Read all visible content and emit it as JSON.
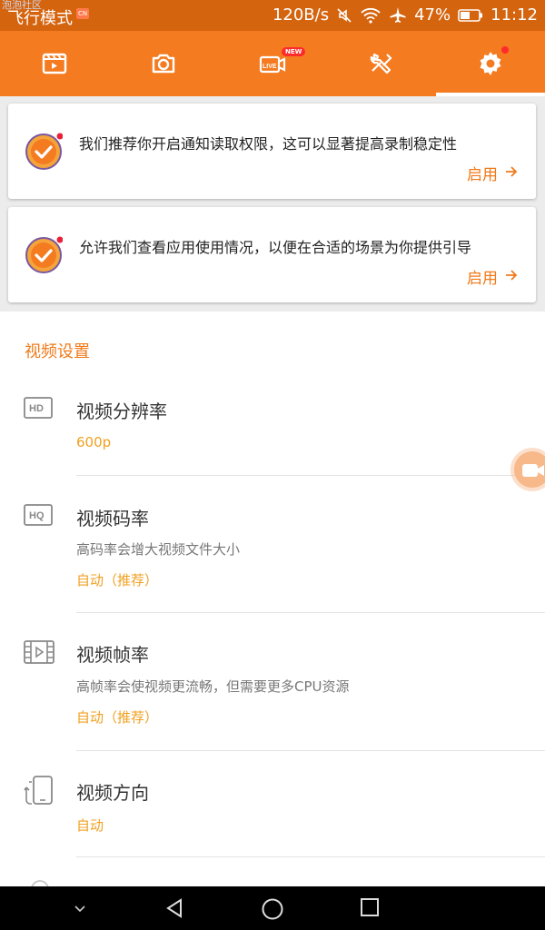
{
  "status_bar": {
    "mode_label": "飞行模式",
    "watermark": "泡泡社区",
    "badge": "CN",
    "net_speed": "120B/s",
    "battery": "47%",
    "time": "11:12",
    "icons": [
      "mute-icon",
      "wifi-icon",
      "airplane-icon",
      "battery-icon"
    ]
  },
  "tabs": [
    {
      "name": "videos",
      "icon": "video-list-icon"
    },
    {
      "name": "screenshots",
      "icon": "camera-icon"
    },
    {
      "name": "live",
      "icon": "live-icon",
      "badge": "NEW"
    },
    {
      "name": "tools",
      "icon": "tools-icon"
    },
    {
      "name": "settings",
      "icon": "gear-icon",
      "active": true,
      "dot": true
    }
  ],
  "cards": [
    {
      "message": "我们推荐你开启通知读取权限，这可以显著提高录制稳定性",
      "action": "启用"
    },
    {
      "message": "允许我们查看应用使用情况，以便在合适的场景为你提供引导",
      "action": "启用"
    }
  ],
  "settings": {
    "section_title": "视频设置",
    "items": [
      {
        "icon": "hd-icon",
        "title": "视频分辨率",
        "value": "600p"
      },
      {
        "icon": "hq-icon",
        "title": "视频码率",
        "subtitle": "高码率会增大视频文件大小",
        "value": "自动（推荐）"
      },
      {
        "icon": "film-icon",
        "title": "视频帧率",
        "subtitle": "高帧率会使视频更流畅，但需要更多CPU资源",
        "value": "自动（推荐）"
      },
      {
        "icon": "orientation-icon",
        "title": "视频方向",
        "value": "自动"
      }
    ]
  },
  "colors": {
    "accent": "#f47b20",
    "status_bar": "#d5640f",
    "value_text": "#f0a020"
  }
}
